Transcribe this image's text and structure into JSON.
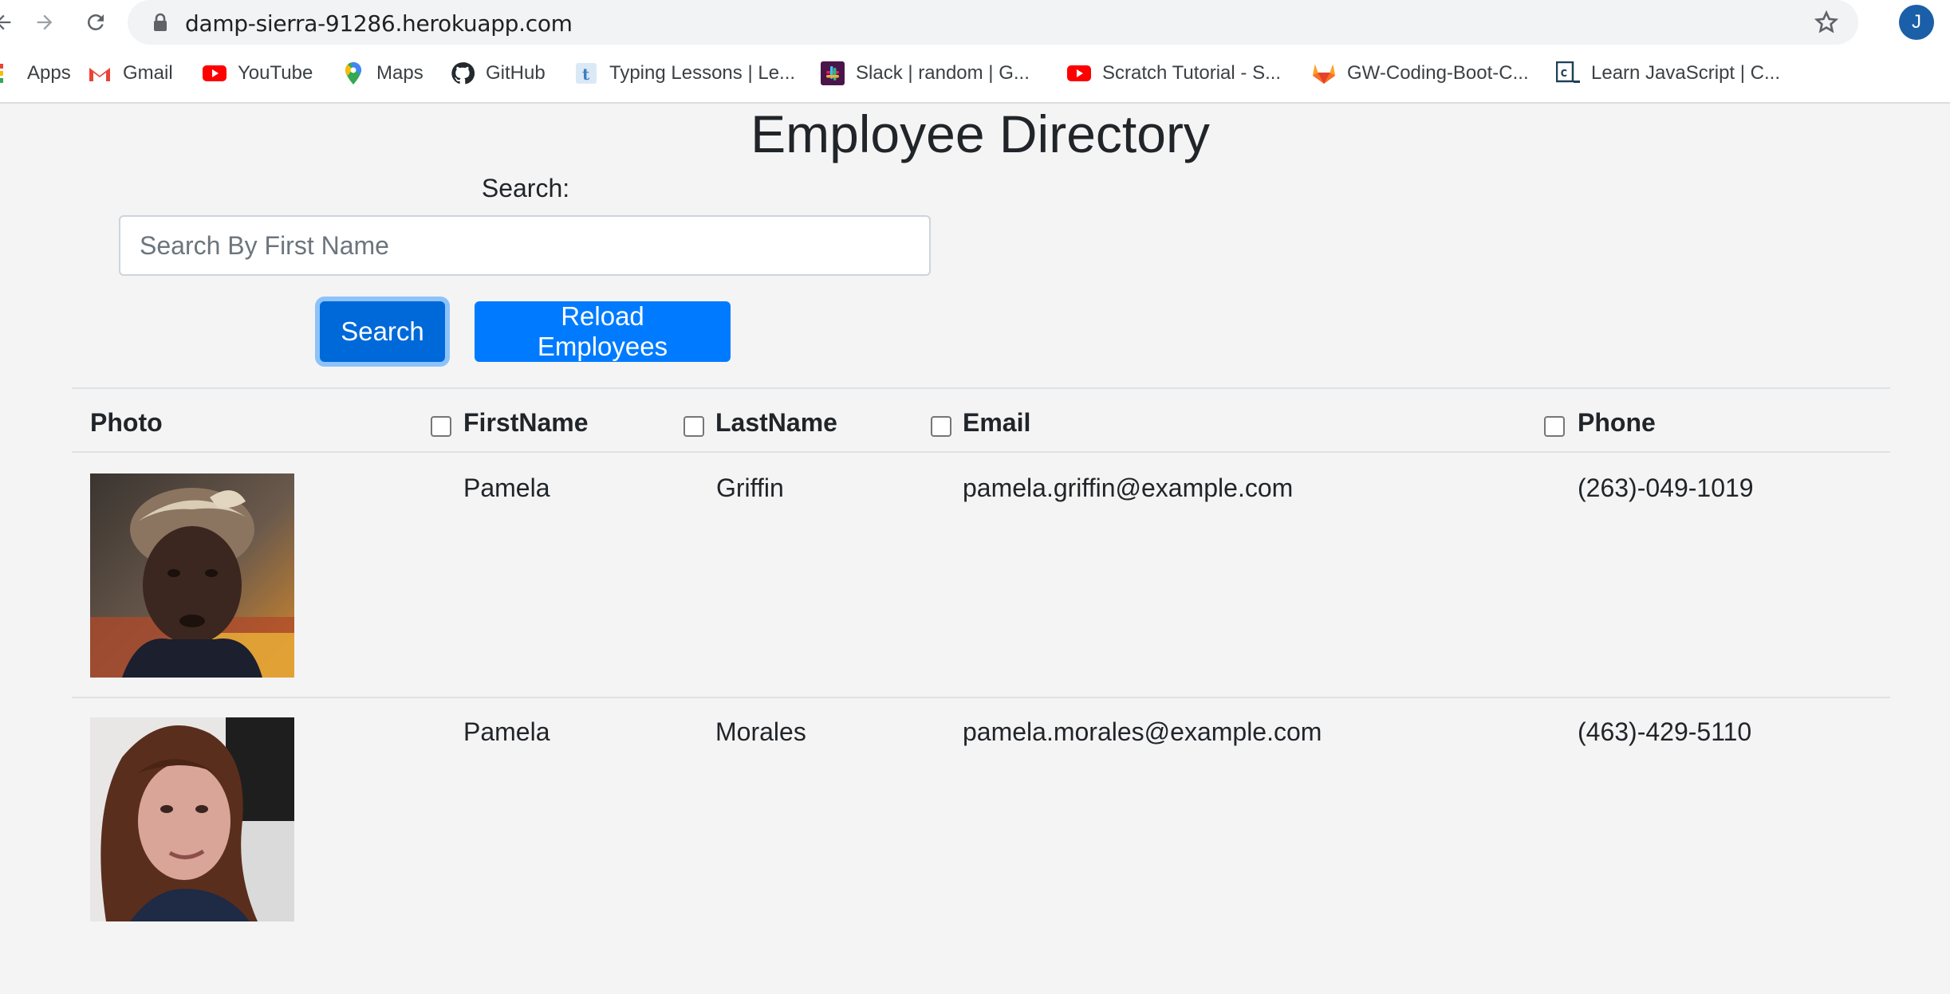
{
  "browser": {
    "url": "damp-sierra-91286.herokuapp.com",
    "profile_initial": "J",
    "bookmarks": [
      {
        "label": "Apps",
        "icon": "apps-grid-icon"
      },
      {
        "label": "Gmail",
        "icon": "gmail-icon"
      },
      {
        "label": "YouTube",
        "icon": "youtube-icon"
      },
      {
        "label": "Maps",
        "icon": "maps-icon"
      },
      {
        "label": "GitHub",
        "icon": "github-icon"
      },
      {
        "label": "Typing Lessons | Le...",
        "icon": "typing-icon"
      },
      {
        "label": "Slack | random | G...",
        "icon": "slack-icon"
      },
      {
        "label": "Scratch Tutorial - S...",
        "icon": "youtube-icon"
      },
      {
        "label": "GW-Coding-Boot-C...",
        "icon": "gitlab-icon"
      },
      {
        "label": "Learn JavaScript | C...",
        "icon": "codecademy-icon"
      }
    ]
  },
  "page": {
    "title": "Employee Directory",
    "search_label": "Search:",
    "search_placeholder": "Search By First Name",
    "search_value": "",
    "search_button": "Search",
    "reload_button": "Reload Employees"
  },
  "table": {
    "headers": {
      "photo": "Photo",
      "first": "FirstName",
      "last": "LastName",
      "email": "Email",
      "phone": "Phone"
    },
    "rows": [
      {
        "first": "Pamela",
        "last": "Griffin",
        "email": "pamela.griffin@example.com",
        "phone": "(263)-049-1019"
      },
      {
        "first": "Pamela",
        "last": "Morales",
        "email": "pamela.morales@example.com",
        "phone": "(463)-429-5110"
      }
    ]
  },
  "colors": {
    "primary": "#007bff",
    "primary_active": "#0069d9",
    "background": "#f4f4f4"
  }
}
